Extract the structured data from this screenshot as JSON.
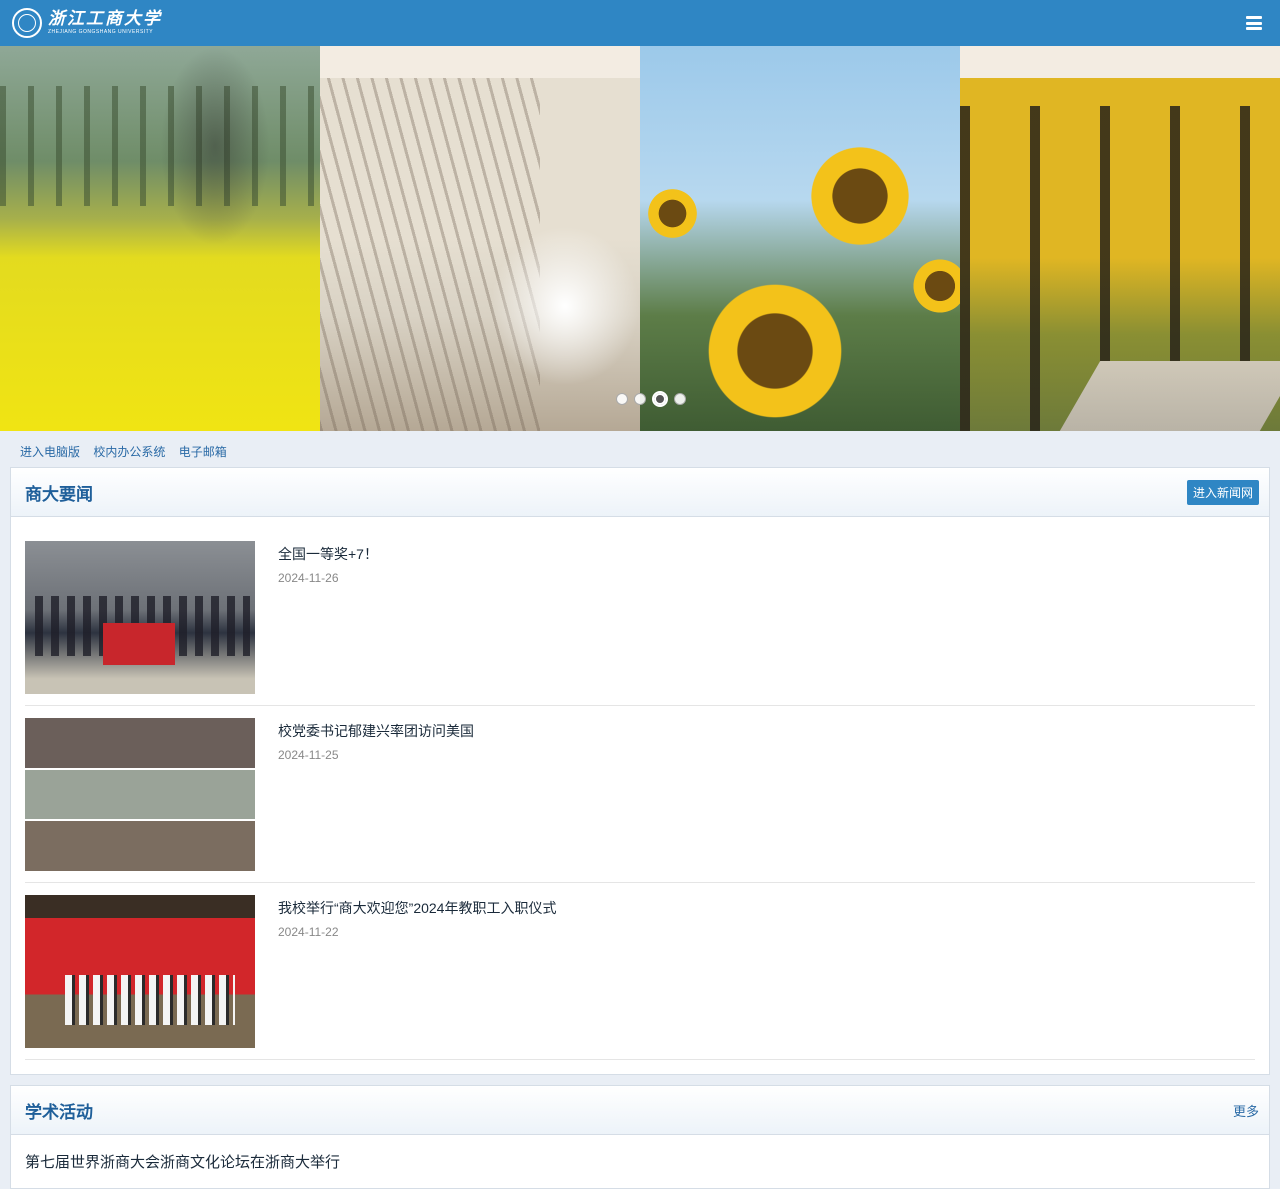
{
  "header": {
    "logo_cn": "浙江工商大学",
    "logo_en": "ZHEJIANG GONGSHANG UNIVERSITY",
    "menu_icon": "hamburger-menu-icon"
  },
  "banner": {
    "slides": [
      "rapeseed-field",
      "blossom-branches",
      "sunflowers",
      "ginkgo-trees"
    ],
    "active_dot": 3,
    "dot_count": 4
  },
  "quick_links": [
    "进入电脑版",
    "校内办公系统",
    "电子邮箱"
  ],
  "news_section": {
    "title": "商大要闻",
    "button_label": "进入新闻网",
    "items": [
      {
        "title": "全国一等奖+7！",
        "date": "2024-11-26"
      },
      {
        "title": "校党委书记郁建兴率团访问美国",
        "date": "2024-11-25"
      },
      {
        "title": "我校举行“商大欢迎您”2024年教职工入职仪式",
        "date": "2024-11-22"
      }
    ]
  },
  "activity_section": {
    "title": "学术活动",
    "more_label": "更多",
    "items": [
      {
        "title": "第七届世界浙商大会浙商文化论坛在浙商大举行"
      }
    ]
  },
  "colors": {
    "header": "#2f86c4",
    "accent_text": "#1f5f9a"
  }
}
